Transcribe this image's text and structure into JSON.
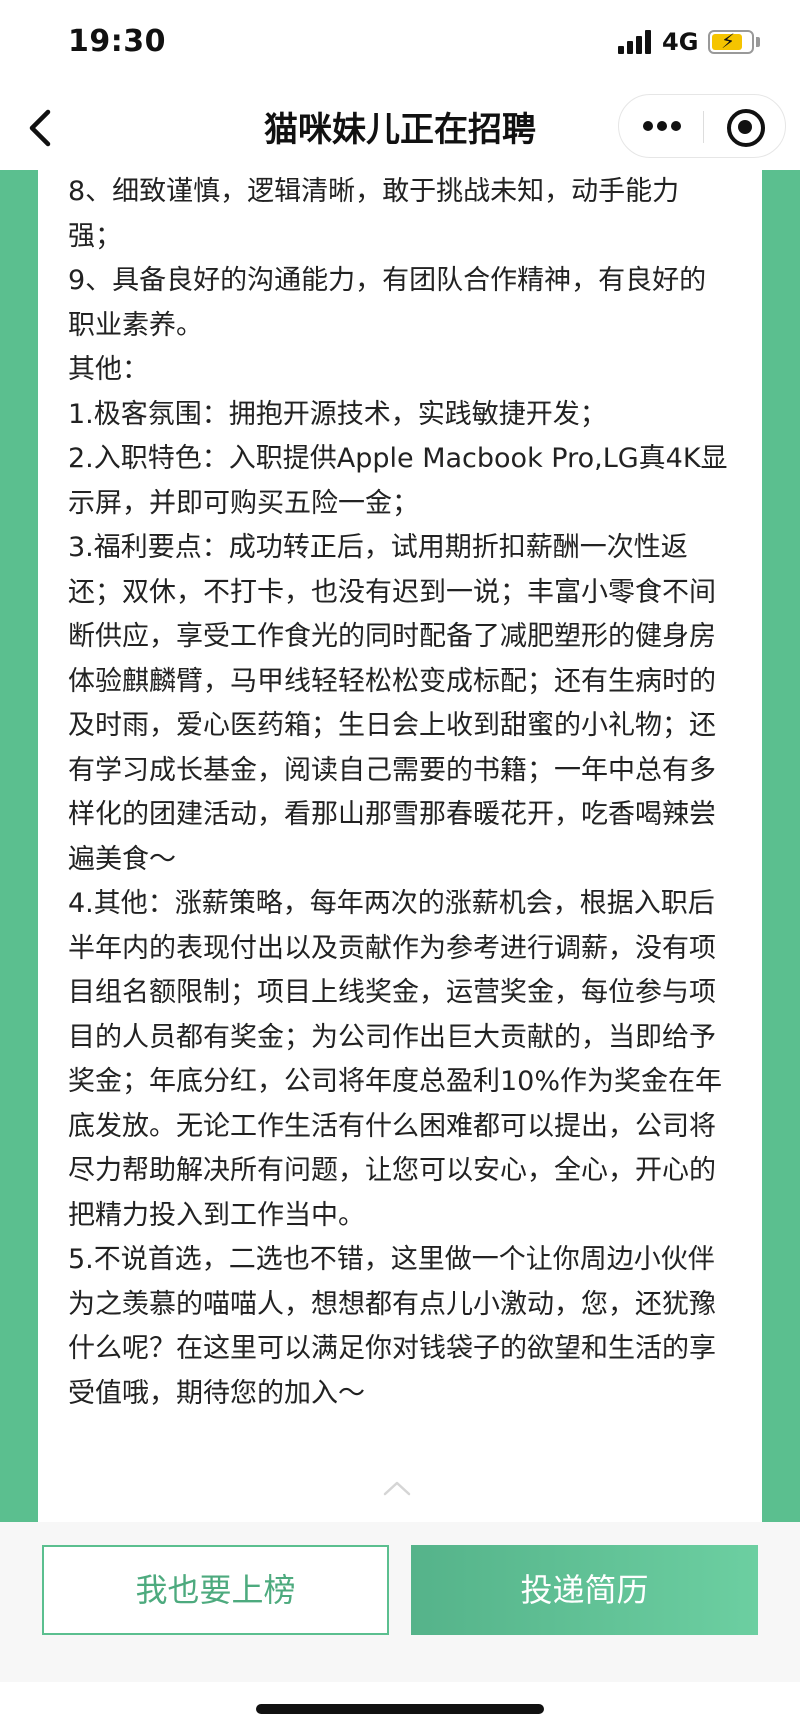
{
  "status_bar": {
    "time": "19:30",
    "network": "4G",
    "battery_level": 0.8
  },
  "nav": {
    "title": "猫咪妹儿正在招聘",
    "icons": [
      "back-icon",
      "more-icon",
      "close-icon"
    ]
  },
  "content": {
    "paragraphs": [
      "8、细致谨慎，逻辑清晰，敢于挑战未知，动手能力强；",
      "9、具备良好的沟通能力，有团队合作精神，有良好的职业素养。",
      "其他：",
      "1.极客氛围：拥抱开源技术，实践敏捷开发；",
      "2.入职特色：入职提供Apple Macbook Pro,LG真4K显示屏，并即可购买五险一金；",
      "3.福利要点：成功转正后，试用期折扣薪酬一次性返还；双休，不打卡，也没有迟到一说；丰富小零食不间断供应，享受工作食光的同时配备了减肥塑形的健身房体验麒麟臂，马甲线轻轻松松变成标配；还有生病时的及时雨，爱心医药箱；生日会上收到甜蜜的小礼物；还有学习成长基金，阅读自己需要的书籍；一年中总有多样化的团建活动，看那山那雪那春暖花开，吃香喝辣尝遍美食～",
      "4.其他：涨薪策略，每年两次的涨薪机会，根据入职后半年内的表现付出以及贡献作为参考进行调薪，没有项目组名额限制；项目上线奖金，运营奖金，每位参与项目的人员都有奖金；为公司作出巨大贡献的，当即给予奖金；年底分红，公司将年度总盈利10%作为奖金在年底发放。无论工作生活有什么困难都可以提出，公司将尽力帮助解决所有问题，让您可以安心，全心，开心的把精力投入到工作当中。",
      "5.不说首选，二选也不错，这里做一个让你周边小伙伴为之羡慕的喵喵人，想想都有点儿小激动，您，还犹豫什么呢？在这里可以满足你对钱袋子的欲望和生活的享受值哦，期待您的加入～"
    ]
  },
  "actions": {
    "rank_button": "我也要上榜",
    "apply_button": "投递简历"
  },
  "colors": {
    "accent": "#5bbf8f",
    "accent_text": "#4daa7e",
    "battery": "#f5c400"
  }
}
